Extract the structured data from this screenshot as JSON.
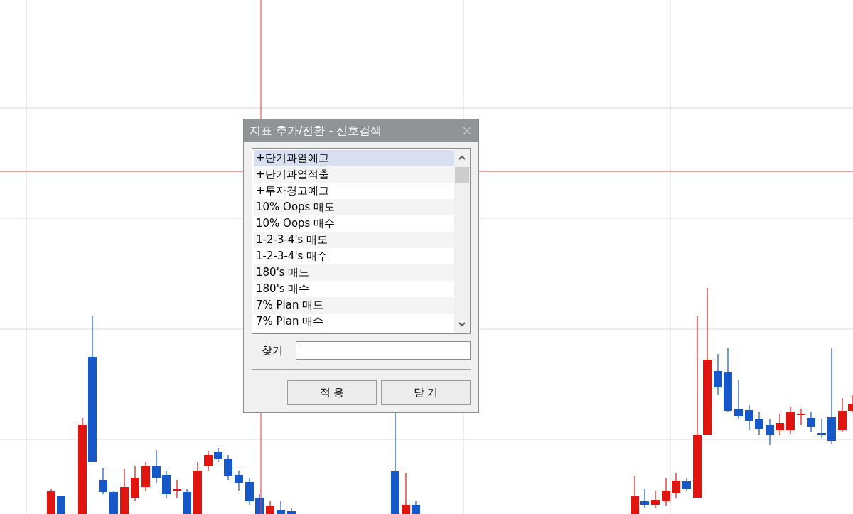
{
  "dialog": {
    "title": "지표 추가/전환 - 신호검색",
    "signal_list": {
      "items": [
        {
          "label": "+단기과열예고",
          "selected": true
        },
        {
          "label": "+단기과열적출",
          "selected": false
        },
        {
          "label": "+투자경고예고",
          "selected": false
        },
        {
          "label": "10% Oops 매도",
          "selected": false
        },
        {
          "label": "10% Oops 매수",
          "selected": false
        },
        {
          "label": "1-2-3-4's  매도",
          "selected": false
        },
        {
          "label": "1-2-3-4's  매수",
          "selected": false
        },
        {
          "label": "180's 매도",
          "selected": false
        },
        {
          "label": "180's 매수",
          "selected": false
        },
        {
          "label": "7% Plan 매도",
          "selected": false
        },
        {
          "label": "7% Plan 매수",
          "selected": false
        }
      ]
    },
    "search": {
      "label": "찾기"
    },
    "buttons": [
      "적 용",
      "닫 기"
    ]
  }
}
